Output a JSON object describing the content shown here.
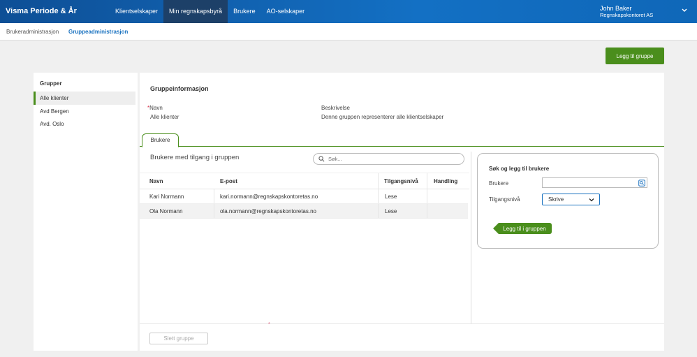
{
  "app": {
    "title": "Visma Periode & År",
    "nav": [
      "Klientselskaper",
      "Min regnskapsbyrå",
      "Brukere",
      "AO-selskaper"
    ],
    "user": {
      "name": "John Baker",
      "company": "Regnskapskontoret AS"
    }
  },
  "subnav": [
    "Brukeradministrasjon",
    "Gruppeadministrasjon"
  ],
  "actions": {
    "add_group": "Legg til gruppe",
    "delete_group": "Slett gruppe"
  },
  "groups": {
    "title": "Grupper",
    "items": [
      "Alle klienter",
      "Avd Bergen",
      "Avd. Oslo"
    ]
  },
  "info": {
    "title": "Gruppeinformasjon",
    "required_mark": "*",
    "name_label": "Navn",
    "name_value": "Alle klienter",
    "desc_label": "Beskrivelse",
    "desc_value": "Denne gruppen representerer alle klientselskaper"
  },
  "tab": "Brukere",
  "users": {
    "title": "Brukere med tilgang i gruppen",
    "search_placeholder": "Søk...",
    "columns": [
      "Navn",
      "E-post",
      "Tilgangsnivå",
      "Handling"
    ],
    "rows": [
      [
        "Kari Normann",
        "kari.normann@regnskapskontoretas.no",
        "Lese",
        ""
      ],
      [
        "Ola Normann",
        "ola.normann@regnskapskontoretas.no",
        "Lese",
        ""
      ]
    ]
  },
  "add_panel": {
    "title": "Søk og legg til brukere",
    "users_label": "Brukere",
    "access_label": "Tilgangsnivå",
    "access_value": "Skrive",
    "add_button": "Legg til i gruppen"
  },
  "marker": "*",
  "colors": {
    "brand": "#1370c4",
    "accent": "#4a8e1c",
    "nav_active": "#1d4068"
  }
}
